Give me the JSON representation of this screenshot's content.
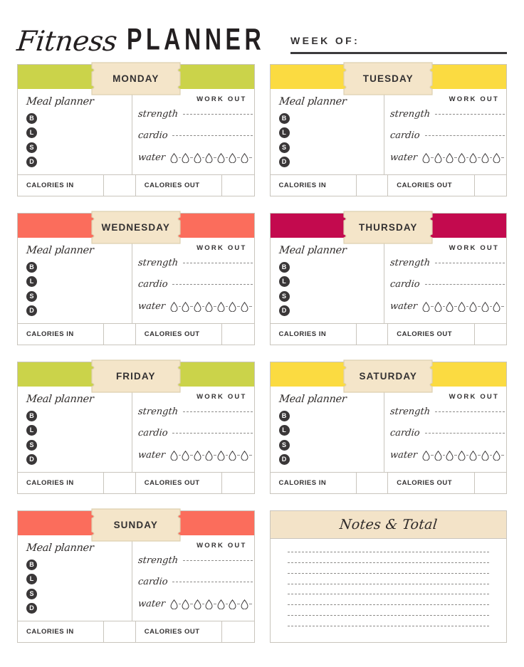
{
  "header": {
    "title_script": "Fitness",
    "title_main": "PLANNER",
    "week_of_label": "WEEK OF:",
    "week_of_value": ""
  },
  "labels": {
    "meal_planner": "Meal planner",
    "work_out": "WORK OUT",
    "strength": "strength",
    "cardio": "cardio",
    "water": "water",
    "calories_in": "CALORIES IN",
    "calories_out": "CALORIES OUT",
    "meals": [
      "B",
      "L",
      "S",
      "D"
    ],
    "water_drop_count": 7
  },
  "colors": {
    "green": "#cbd34a",
    "yellow": "#fbdb41",
    "coral": "#fb6d5c",
    "magenta": "#c30a4e",
    "tab_cream": "#f4e5c9",
    "tab_border": "#ddd0b0",
    "card_border": "#c9c5bd",
    "text": "#333132",
    "dash": "#8d8b89"
  },
  "days": [
    {
      "name": "MONDAY",
      "color": "#cbd34a"
    },
    {
      "name": "TUESDAY",
      "color": "#fbdb41"
    },
    {
      "name": "WEDNESDAY",
      "color": "#fb6d5c"
    },
    {
      "name": "THURSDAY",
      "color": "#c30a4e"
    },
    {
      "name": "FRIDAY",
      "color": "#cbd34a"
    },
    {
      "name": "SATURDAY",
      "color": "#fbdb41"
    },
    {
      "name": "SUNDAY",
      "color": "#fb6d5c"
    }
  ],
  "notes": {
    "title": "Notes & Total",
    "line_count": 8
  }
}
